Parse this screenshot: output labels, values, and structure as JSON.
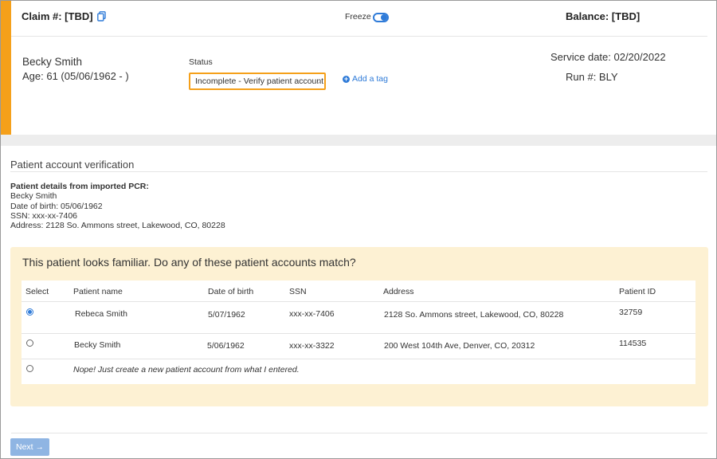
{
  "header": {
    "claim_label": "Claim #: [TBD]",
    "freeze_label": "Freeze",
    "freeze_on": true,
    "balance_label": "Balance: [TBD]"
  },
  "patient": {
    "name": "Becky Smith",
    "age_line": "Age: 61  (05/06/1962 - )",
    "service_date": "Service date: 02/20/2022",
    "run_no": "Run #: BLY"
  },
  "status": {
    "label": "Status",
    "selected": "Incomplete - Verify patient account"
  },
  "tags": {
    "add_label": "Add a tag"
  },
  "verification": {
    "section_title": "Patient account verification",
    "pcr_heading": "Patient details from imported PCR:",
    "pcr_lines": [
      "Becky Smith",
      "Date of birth: 05/06/1962",
      "SSN: xxx-xx-7406",
      "Address: 2128 So. Ammons street, Lakewood, CO, 80228"
    ]
  },
  "match": {
    "prompt": "This patient looks familiar. Do any of these patient accounts match?",
    "columns": {
      "select": "Select",
      "name": "Patient name",
      "dob": "Date of birth",
      "ssn": "SSN",
      "address": "Address",
      "pid": "Patient ID"
    },
    "rows": [
      {
        "selected": true,
        "name": "Rebeca Smith",
        "dob": "5/07/1962",
        "ssn": "xxx-xx-7406",
        "address": "2128 So. Ammons street, Lakewood, CO, 80228",
        "pid": "32759"
      },
      {
        "selected": false,
        "name": "Becky Smith",
        "dob": "5/06/1962",
        "ssn": "xxx-xx-3322",
        "address": "200 West 104th Ave, Denver, CO, 20312",
        "pid": "114535"
      }
    ],
    "none_option": "Nope! Just create a new patient account from what I entered."
  },
  "footer": {
    "next_label": "Next →"
  },
  "colors": {
    "accent": "#f5a01a",
    "link": "#2f7bd8",
    "highlight_bg": "#fdf1d3",
    "next_button": "#8fb5e3"
  }
}
